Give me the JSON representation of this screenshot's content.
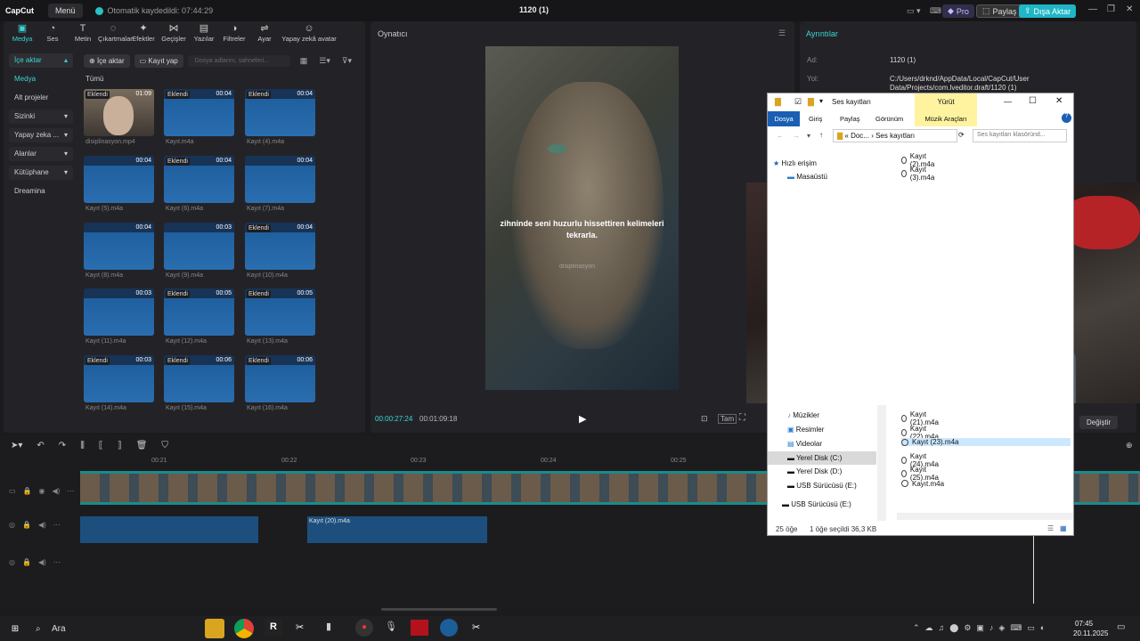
{
  "app": {
    "logo": "CapCut",
    "menu": "Menü",
    "autosave": "Otomatik kaydedildi: 07:44:29",
    "title": "1120 (1)",
    "pro": "Pro",
    "share": "Paylaş",
    "upgrade": "Dışa Aktar"
  },
  "toolbar": [
    "Medya",
    "Ses",
    "Metin",
    "Çıkartmalar",
    "Efektler",
    "Geçişler",
    "Yazılar",
    "Filtreler",
    "Ayar",
    "Yapay zekâ avatar"
  ],
  "sidebar": [
    "İçe aktar",
    "Medya",
    "Alt projeler",
    "Sizinki",
    "Yapay zeka ...",
    "Alanlar",
    "Kütüphane",
    "Dreamina"
  ],
  "media": {
    "import": "İçe aktar",
    "record": "Kayıt yap",
    "search_placeholder": "Dosya adlarını, sahneleri...",
    "all": "Tümü"
  },
  "cards": [
    {
      "tag": "Eklendi",
      "dur": "01:09",
      "name": "disiplinasyon.mp4"
    },
    {
      "tag": "Eklendi",
      "dur": "00:04",
      "name": "Kayıt.m4a"
    },
    {
      "tag": "Eklendi",
      "dur": "00:04",
      "name": "Kayıt (4).m4a"
    },
    {
      "tag": "",
      "dur": "00:04",
      "name": "Kayıt (5).m4a"
    },
    {
      "tag": "Eklendi",
      "dur": "00:04",
      "name": "Kayıt (6).m4a"
    },
    {
      "tag": "",
      "dur": "00:04",
      "name": "Kayıt (7).m4a"
    },
    {
      "tag": "",
      "dur": "00:04",
      "name": "Kayıt (8).m4a"
    },
    {
      "tag": "",
      "dur": "00:03",
      "name": "Kayıt (9).m4a"
    },
    {
      "tag": "Eklendi",
      "dur": "00:04",
      "name": "Kayıt (10).m4a"
    },
    {
      "tag": "",
      "dur": "00:03",
      "name": "Kayıt (11).m4a"
    },
    {
      "tag": "Eklendi",
      "dur": "00:05",
      "name": "Kayıt (12).m4a"
    },
    {
      "tag": "Eklendi",
      "dur": "00:05",
      "name": "Kayıt (13).m4a"
    },
    {
      "tag": "Eklendi",
      "dur": "00:03",
      "name": "Kayıt (14).m4a"
    },
    {
      "tag": "Eklendi",
      "dur": "00:06",
      "name": "Kayıt (15).m4a"
    },
    {
      "tag": "Eklendi",
      "dur": "00:06",
      "name": "Kayıt (16).m4a"
    }
  ],
  "player": {
    "label": "Oynatıcı",
    "caption": "zihninde seni huzurlu hissettiren kelimeleri tekrarla.",
    "watermark": "disiplinasyon",
    "time_current": "00:00:27:24",
    "time_total": "00:01:09:18",
    "ratio": "Tam"
  },
  "details": {
    "label": "Ayrıntılar",
    "name_label": "Ad:",
    "name": "1120 (1)",
    "path_label": "Yol:",
    "path": "C:/Users/drknd/AppData/Local/CapCut/User Data/Projects/com.lveditor.draft/1120 (1)",
    "change": "Değiştir"
  },
  "timeline": {
    "ticks": [
      "00:21",
      "00:22",
      "00:23",
      "00:24",
      "00:25"
    ],
    "audio_clip": "Kayıt (20).m4a"
  },
  "explorer": {
    "title": "Ses kayıtları",
    "play_tab": "Yürüt",
    "tabs": [
      "Dosya",
      "Giriş",
      "Paylaş",
      "Görünüm",
      "Müzik Araçları"
    ],
    "breadcrumb": [
      "Doc...",
      "Ses kayıtları"
    ],
    "search_placeholder": "Ses kayıtları klasöründ...",
    "nav": [
      "Hızlı erişim",
      "Masaüstü",
      "Müzikler",
      "Resimler",
      "Videolar",
      "Yerel Disk (C:)",
      "Yerel Disk (D:)",
      "USB Sürücüsü (E:)",
      "USB Sürücüsü (E:)"
    ],
    "files_top": [
      "Kayıt (2).m4a",
      "Kayıt (3).m4a"
    ],
    "files": [
      "Kayıt (21).m4a",
      "Kayıt (22).m4a",
      "Kayıt (23).m4a",
      "Kayıt (24).m4a",
      "Kayıt (25).m4a",
      "Kayıt.m4a"
    ],
    "status_count": "25 öğe",
    "status_sel": "1 öğe seçildi  36,3 KB"
  },
  "taskbar": {
    "search": "Ara",
    "time": "07:45",
    "date": "20.11.2025"
  }
}
